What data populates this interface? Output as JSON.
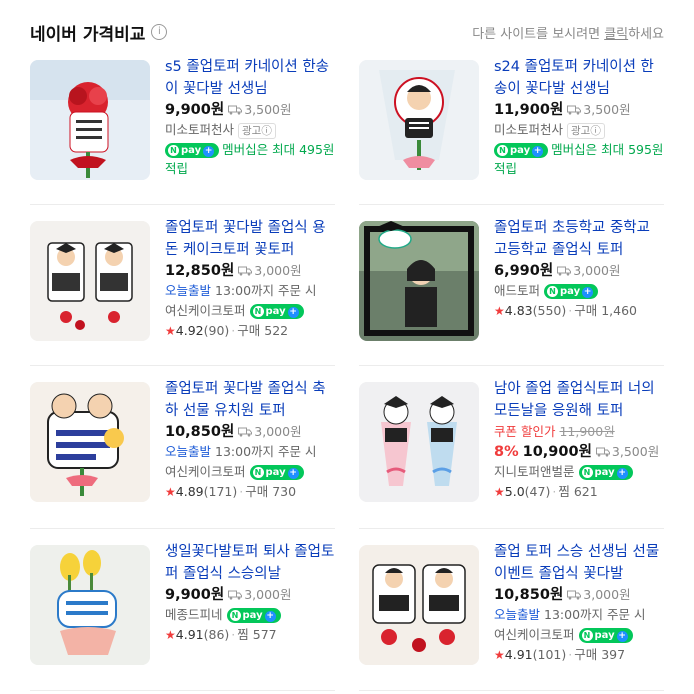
{
  "header": {
    "title": "네이버 가격비교",
    "info_icon": "info-circle-icon",
    "hint_pre": "다른 사이트를 보시려면 ",
    "hint_link": "클릭",
    "hint_post": "하세요"
  },
  "products": [
    {
      "title": "s5 졸업토퍼 카네이션 한송이 꽃다발 선생님",
      "price": "9,900원",
      "shipping": "3,500원",
      "seller": "미소토퍼천사",
      "ad": "광고ⓘ",
      "npay": "pay",
      "membership": "멤버십은 최대 495원 적립"
    },
    {
      "title": "s24 졸업토퍼 카네이션 한송이 꽃다발 선생님",
      "price": "11,900원",
      "shipping": "3,500원",
      "seller": "미소토퍼천사",
      "ad": "광고ⓘ",
      "npay": "pay",
      "membership": "멤버십은 최대 595원 적립"
    },
    {
      "title": "졸업토퍼 꽃다발 졸업식 용돈 케이크토퍼 꽃토퍼",
      "price": "12,850원",
      "shipping": "3,000원",
      "today_ship": "오늘출발",
      "today_ship_detail": "13:00까지 주문 시",
      "seller": "여신케이크토퍼",
      "npay": "pay",
      "rating": "4.92",
      "reviews": "(90)",
      "purchase_label": "구매",
      "purchase_count": "522"
    },
    {
      "title": "졸업토퍼 초등학교 중학교 고등학교 졸업식 토퍼",
      "price": "6,990원",
      "shipping": "3,000원",
      "seller": "애드토퍼",
      "npay": "pay",
      "rating": "4.83",
      "reviews": "(550)",
      "purchase_label": "구매",
      "purchase_count": "1,460"
    },
    {
      "title": "졸업토퍼 꽃다발 졸업식 축하 선물 유치원 토퍼",
      "price": "10,850원",
      "shipping": "3,000원",
      "today_ship": "오늘출발",
      "today_ship_detail": "13:00까지 주문 시",
      "seller": "여신케이크토퍼",
      "npay": "pay",
      "rating": "4.89",
      "reviews": "(171)",
      "purchase_label": "구매",
      "purchase_count": "730"
    },
    {
      "title": "남아 졸업 졸업식토퍼 너의모든날을 응원해 토퍼",
      "coupon_label": "쿠폰 할인가",
      "original_price": "11,900원",
      "discount": "8%",
      "price": "10,900원",
      "shipping": "3,500원",
      "seller": "지니토퍼앤벌룬",
      "npay": "pay",
      "rating": "5.0",
      "reviews": "(47)",
      "purchase_label": "찜",
      "purchase_count": "621"
    },
    {
      "title": "생일꽃다발토퍼 퇴사 졸업토퍼 졸업식 스승의날",
      "price": "9,900원",
      "shipping": "3,000원",
      "seller": "메종드피네",
      "npay": "pay",
      "rating": "4.91",
      "reviews": "(86)",
      "purchase_label": "찜",
      "purchase_count": "577"
    },
    {
      "title": "졸업 토퍼 스승 선생님 선물 이벤트 졸업식 꽃다발",
      "price": "10,850원",
      "shipping": "3,000원",
      "today_ship": "오늘출발",
      "today_ship_detail": "13:00까지 주문 시",
      "seller": "여신케이크토퍼",
      "npay": "pay",
      "rating": "4.91",
      "reviews": "(101)",
      "purchase_label": "구매",
      "purchase_count": "397"
    }
  ]
}
